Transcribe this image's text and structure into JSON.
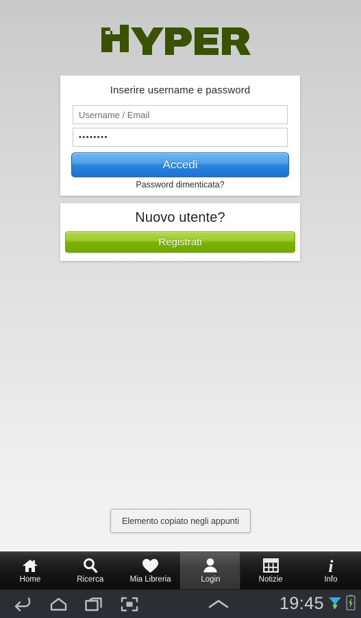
{
  "app": {
    "logo_text": "HYPER",
    "logo_color": "#3a5200"
  },
  "login_card": {
    "title": "Inserire username e password",
    "username": {
      "placeholder": "Username / Email",
      "value": ""
    },
    "password": {
      "value": "••••••••",
      "masked_length": 8
    },
    "submit_label": "Accedi",
    "submit_color": "#2a83dd",
    "forgot_label": "Password dimenticata?"
  },
  "register_card": {
    "title": "Nuovo utente?",
    "button_label": "Registrati",
    "button_color": "#7eb300"
  },
  "toast": {
    "message": "Elemento copiato negli appunti"
  },
  "tabbar": {
    "active_index": 3,
    "items": [
      {
        "label": "Home",
        "icon": "home-icon",
        "active": false
      },
      {
        "label": "Ricerca",
        "icon": "search-icon",
        "active": false
      },
      {
        "label": "Mia Libreria",
        "icon": "heart-icon",
        "active": false
      },
      {
        "label": "Login",
        "icon": "person-icon",
        "active": true
      },
      {
        "label": "Notizie",
        "icon": "grid-icon",
        "active": false
      },
      {
        "label": "Info",
        "icon": "info-icon",
        "active": false
      }
    ]
  },
  "systembar": {
    "buttons": [
      {
        "icon": "back-icon"
      },
      {
        "icon": "home-icon"
      },
      {
        "icon": "recents-icon"
      },
      {
        "icon": "screenshot-icon"
      },
      {
        "icon": "chevron-up-icon"
      }
    ],
    "clock": "19:45",
    "status_icons": [
      {
        "icon": "wifi-icon"
      },
      {
        "icon": "battery-charging-icon"
      }
    ]
  }
}
